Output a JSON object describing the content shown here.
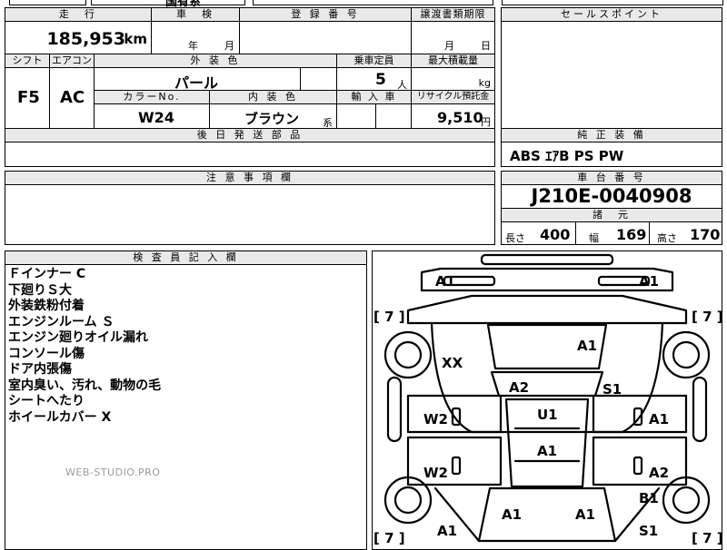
{
  "top_partial": {
    "text": "国有系"
  },
  "mileage": {
    "header": "走　行",
    "value": "185,953",
    "unit": "km"
  },
  "inspection": {
    "header": "車　検",
    "year": "年",
    "month": "月"
  },
  "registration": {
    "header": "登 録 番 号",
    "value": ""
  },
  "transfer": {
    "header": "譲渡書類期限",
    "month": "月",
    "day": "日"
  },
  "sales_point": {
    "header": "セールスポイント"
  },
  "shift": {
    "header": "シフト",
    "value": "F5"
  },
  "aircon": {
    "header": "エアコン",
    "value": "AC"
  },
  "exterior": {
    "header": "外 装 色",
    "value": "パール"
  },
  "capacity": {
    "header": "乗車定員",
    "value": "5",
    "unit": "人"
  },
  "max_load": {
    "header": "最大積載量",
    "unit": "kg"
  },
  "color_no": {
    "header": "カラーNo.",
    "value": "W24"
  },
  "interior": {
    "header": "内 装 色",
    "value": "ブラウン",
    "suffix": "系"
  },
  "import": {
    "header": "輸 入 車"
  },
  "recycle": {
    "header": "リサイクル預託金",
    "value": "9,510",
    "unit": "円"
  },
  "later_parts": {
    "header": "後 日 発 送 部 品"
  },
  "equipment": {
    "header": "純 正 装 備",
    "value": "ABS  ｴｱB  PS  PW"
  },
  "caution": {
    "header": "注 意 事 項 欄"
  },
  "chassis": {
    "header": "車 台 番 号",
    "value": "J210E-0040908"
  },
  "specs": {
    "header": "諸　元",
    "length_label": "長さ",
    "length": "400",
    "width_label": "幅",
    "width": "169",
    "height_label": "高さ",
    "height": "170"
  },
  "inspector": {
    "header": "検 査 員 記 入 欄",
    "notes": [
      "Ｆインナー C",
      "下廻りＳ大",
      "外装鉄粉付着",
      "エンジンルーム Ｓ",
      "エンジン廻りオイル漏れ",
      "コンソール傷",
      "ドア内張傷",
      "室内臭い、汚れ、動物の毛",
      "シートへたり",
      "ホイールカバー X"
    ]
  },
  "watermark": "WEB-STUDIO.PRO",
  "diagram": {
    "labels": [
      "A1",
      "A1",
      "A1",
      "XX",
      "A2",
      "S1",
      "W2",
      "U1",
      "A1",
      "A1",
      "W2",
      "A2",
      "B1",
      "A1",
      "A1",
      "A1",
      "S1"
    ],
    "brackets": [
      "[ 7 ]",
      "[ 7 ]",
      "[ 7 ]",
      "[ 7 ]"
    ]
  },
  "colors": {
    "header_bg": "#e9e9e9",
    "watermark": "#9a9a9a"
  }
}
